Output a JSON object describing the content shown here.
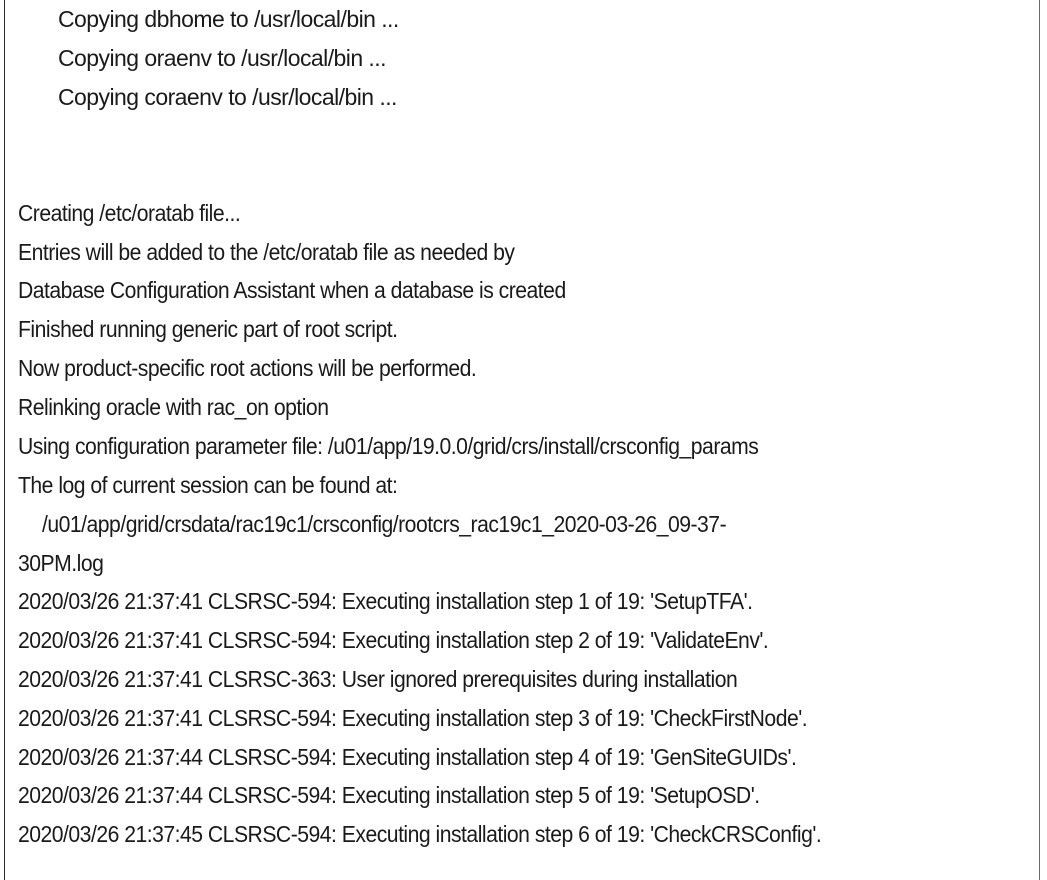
{
  "document": {
    "type": "terminal-log-excerpt",
    "lines": [
      "Copying dbhome to /usr/local/bin ...",
      "Copying oraenv to /usr/local/bin ...",
      "Copying coraenv to /usr/local/bin ...",
      "",
      "",
      "Creating /etc/oratab file...",
      "Entries will be added to the /etc/oratab file as needed by",
      "Database Configuration Assistant when a database is created",
      "Finished running generic part of root script.",
      "Now product-specific root actions will be performed.",
      "Relinking oracle with rac_on option",
      "Using configuration parameter file: /u01/app/19.0.0/grid/crs/install/crsconfig_params",
      "The log of current session can be found at:",
      "/u01/app/grid/crsdata/rac19c1/crsconfig/rootcrs_rac19c1_2020-03-26_09-37-",
      "30PM.log",
      "2020/03/26 21:37:41 CLSRSC-594: Executing installation step 1 of 19: 'SetupTFA'.",
      "2020/03/26 21:37:41 CLSRSC-594: Executing installation step 2 of 19: 'ValidateEnv'.",
      "2020/03/26 21:37:41 CLSRSC-363: User ignored prerequisites during installation",
      "2020/03/26 21:37:41 CLSRSC-594: Executing installation step 3 of 19: 'CheckFirstNode'.",
      "2020/03/26 21:37:44 CLSRSC-594: Executing installation step 4 of 19: 'GenSiteGUIDs'.",
      "2020/03/26 21:37:44 CLSRSC-594: Executing installation step 5 of 19: 'SetupOSD'.",
      "2020/03/26 21:37:45 CLSRSC-594: Executing installation step 6 of 19: 'CheckCRSConfig'."
    ]
  }
}
